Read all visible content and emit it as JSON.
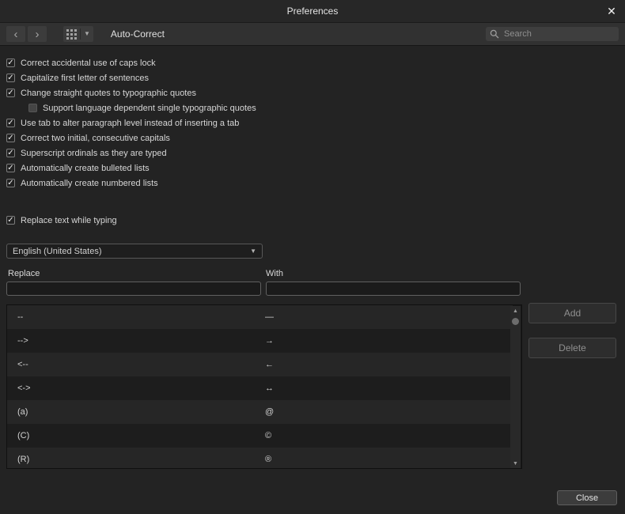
{
  "window": {
    "title": "Preferences"
  },
  "icons": {
    "back": "‹",
    "forward": "›",
    "dropdown_caret": "▼",
    "scroll_up": "▲",
    "scroll_down": "▼",
    "close": "✕",
    "check": "✓"
  },
  "toolbar": {
    "section_title": "Auto-Correct",
    "search_placeholder": "Search"
  },
  "options": [
    {
      "label": "Correct accidental use of caps lock",
      "checked": true,
      "indent": false
    },
    {
      "label": "Capitalize first letter of sentences",
      "checked": true,
      "indent": false
    },
    {
      "label": "Change straight quotes to typographic quotes",
      "checked": true,
      "indent": false
    },
    {
      "label": "Support language dependent single typographic quotes",
      "checked": false,
      "indent": true
    },
    {
      "label": "Use tab to alter paragraph level instead of inserting a tab",
      "checked": true,
      "indent": false
    },
    {
      "label": "Correct two initial, consecutive capitals",
      "checked": true,
      "indent": false
    },
    {
      "label": "Superscript ordinals as they are typed",
      "checked": true,
      "indent": false
    },
    {
      "label": "Automatically create bulleted lists",
      "checked": true,
      "indent": false
    },
    {
      "label": "Automatically create numbered lists",
      "checked": true,
      "indent": false
    }
  ],
  "replace_while_typing": {
    "label": "Replace text while typing",
    "checked": true
  },
  "language_select": {
    "value": "English (United States)"
  },
  "replace_section": {
    "replace_label": "Replace",
    "with_label": "With",
    "replace_value": "",
    "with_value": "",
    "rows": [
      {
        "replace": "--",
        "with": "—"
      },
      {
        "replace": "-->",
        "with": "→"
      },
      {
        "replace": "<--",
        "with": "←"
      },
      {
        "replace": "<->",
        "with": "↔"
      },
      {
        "replace": "(a)",
        "with": "@"
      },
      {
        "replace": "(C)",
        "with": "©"
      },
      {
        "replace": "(R)",
        "with": "®"
      }
    ]
  },
  "buttons": {
    "add": "Add",
    "delete": "Delete",
    "close": "Close"
  },
  "colors": {
    "window_bg": "#232323",
    "toolbar_bg": "#313131",
    "table_row_odd": "#262626",
    "table_row_even": "#1d1d1d"
  }
}
